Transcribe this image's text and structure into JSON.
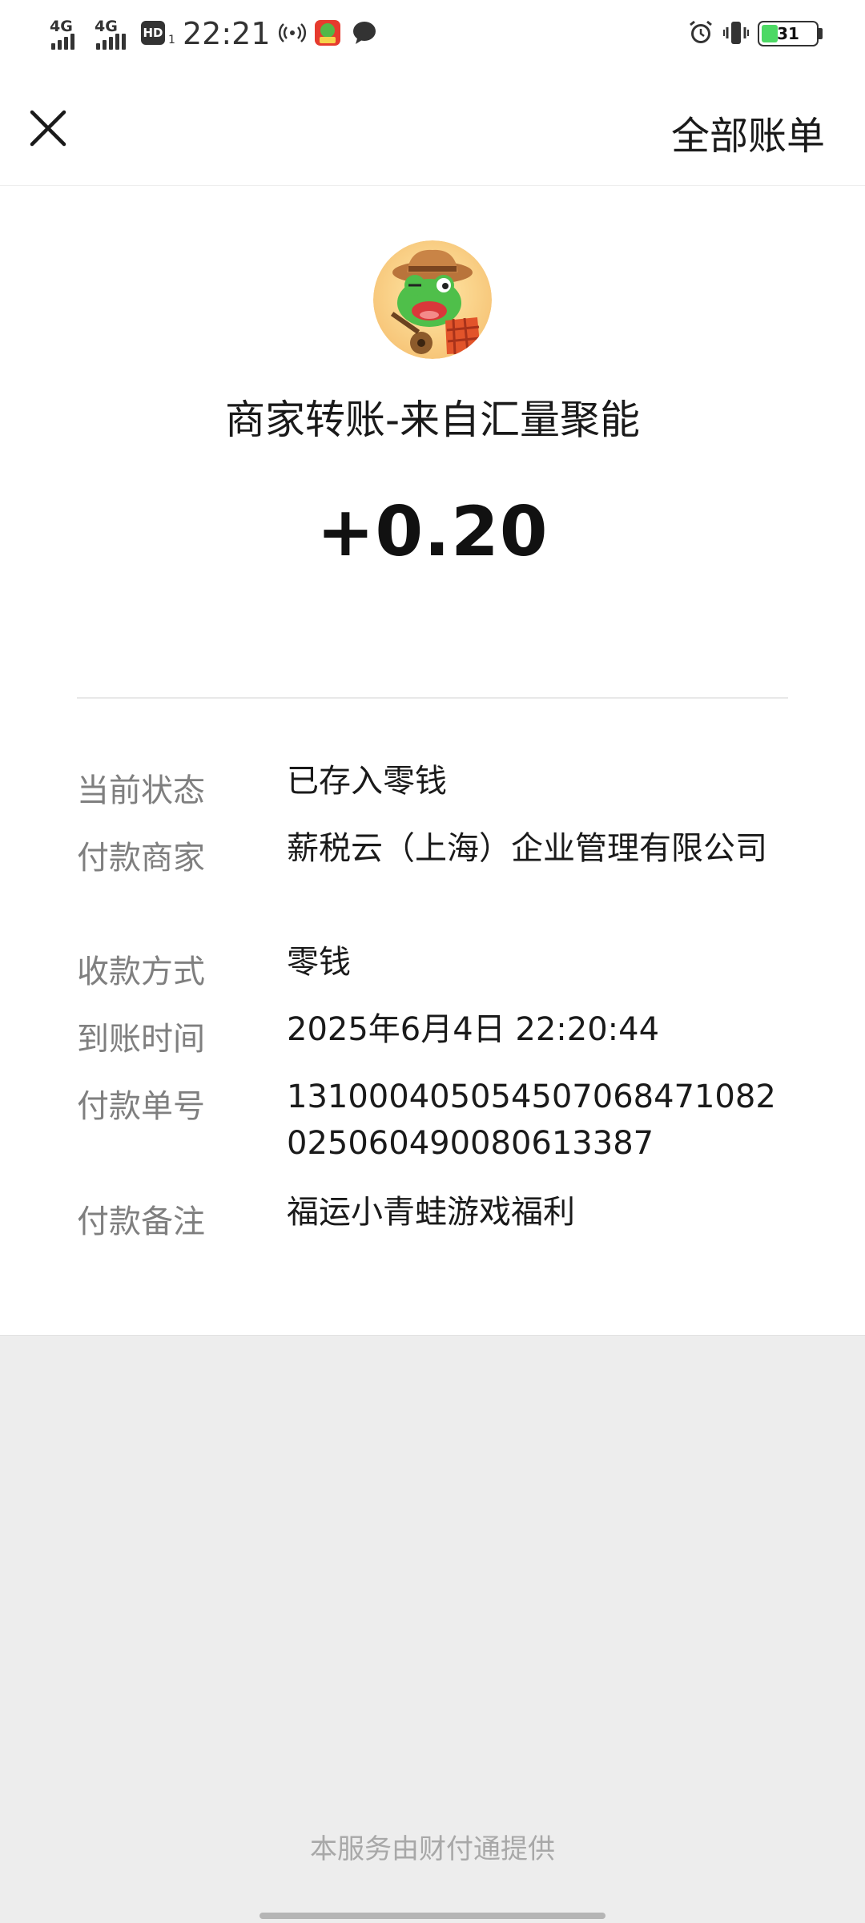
{
  "status_bar": {
    "signal1_label": "4G",
    "signal2_label": "4G",
    "hd_label": "HD",
    "hd_sub": "1",
    "time": "22:21",
    "battery_percent": "31",
    "battery_level": 0.31
  },
  "nav": {
    "close_icon": "close-icon",
    "right_link": "全部账单"
  },
  "header": {
    "merchant_title": "商家转账-来自汇量聚能",
    "amount": "+0.20"
  },
  "details": [
    {
      "label": "当前状态",
      "value": "已存入零钱"
    },
    {
      "label": "付款商家",
      "value": "薪税云（上海）企业管理有限公司"
    },
    {
      "label": "收款方式",
      "value": "零钱"
    },
    {
      "label": "到账时间",
      "value": "2025年6月4日 22:20:44"
    },
    {
      "label": "付款单号",
      "value": "131000405054507068471082025060490080613387"
    },
    {
      "label": "付款备注",
      "value": "福运小青蛙游戏福利"
    }
  ],
  "footer": {
    "service_text": "本服务由财付通提供"
  },
  "colors": {
    "accent_battery": "#4cd964",
    "label_gray": "#7f7f7f",
    "bottom_bg": "#ededed"
  }
}
